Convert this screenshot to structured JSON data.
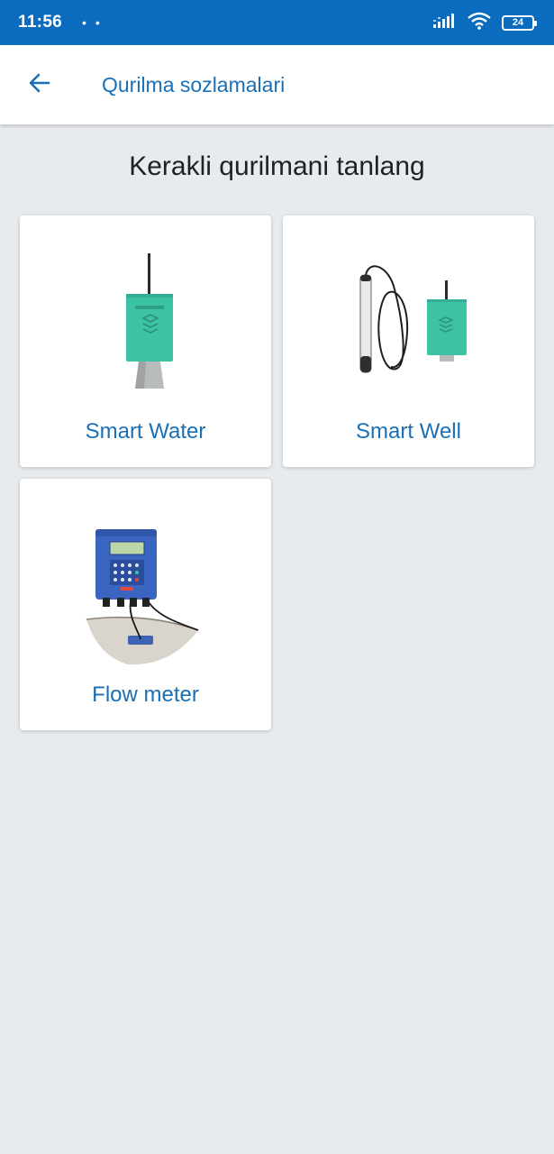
{
  "status_bar": {
    "time": "11:56",
    "dots": "• •",
    "battery": "24"
  },
  "app_bar": {
    "title": "Qurilma sozlamalari",
    "back_icon": "arrow-back-icon"
  },
  "heading": "Kerakli qurilmani tanlang",
  "devices": [
    {
      "label": "Smart Water",
      "image": "smart-water-device"
    },
    {
      "label": "Smart Well",
      "image": "smart-well-device"
    },
    {
      "label": "Flow meter",
      "image": "flow-meter-device"
    }
  ],
  "colors": {
    "status_bar": "#0b6cbf",
    "accent": "#1a6fb5",
    "background": "#e8ebee",
    "device_teal": "#3cc3a6"
  }
}
